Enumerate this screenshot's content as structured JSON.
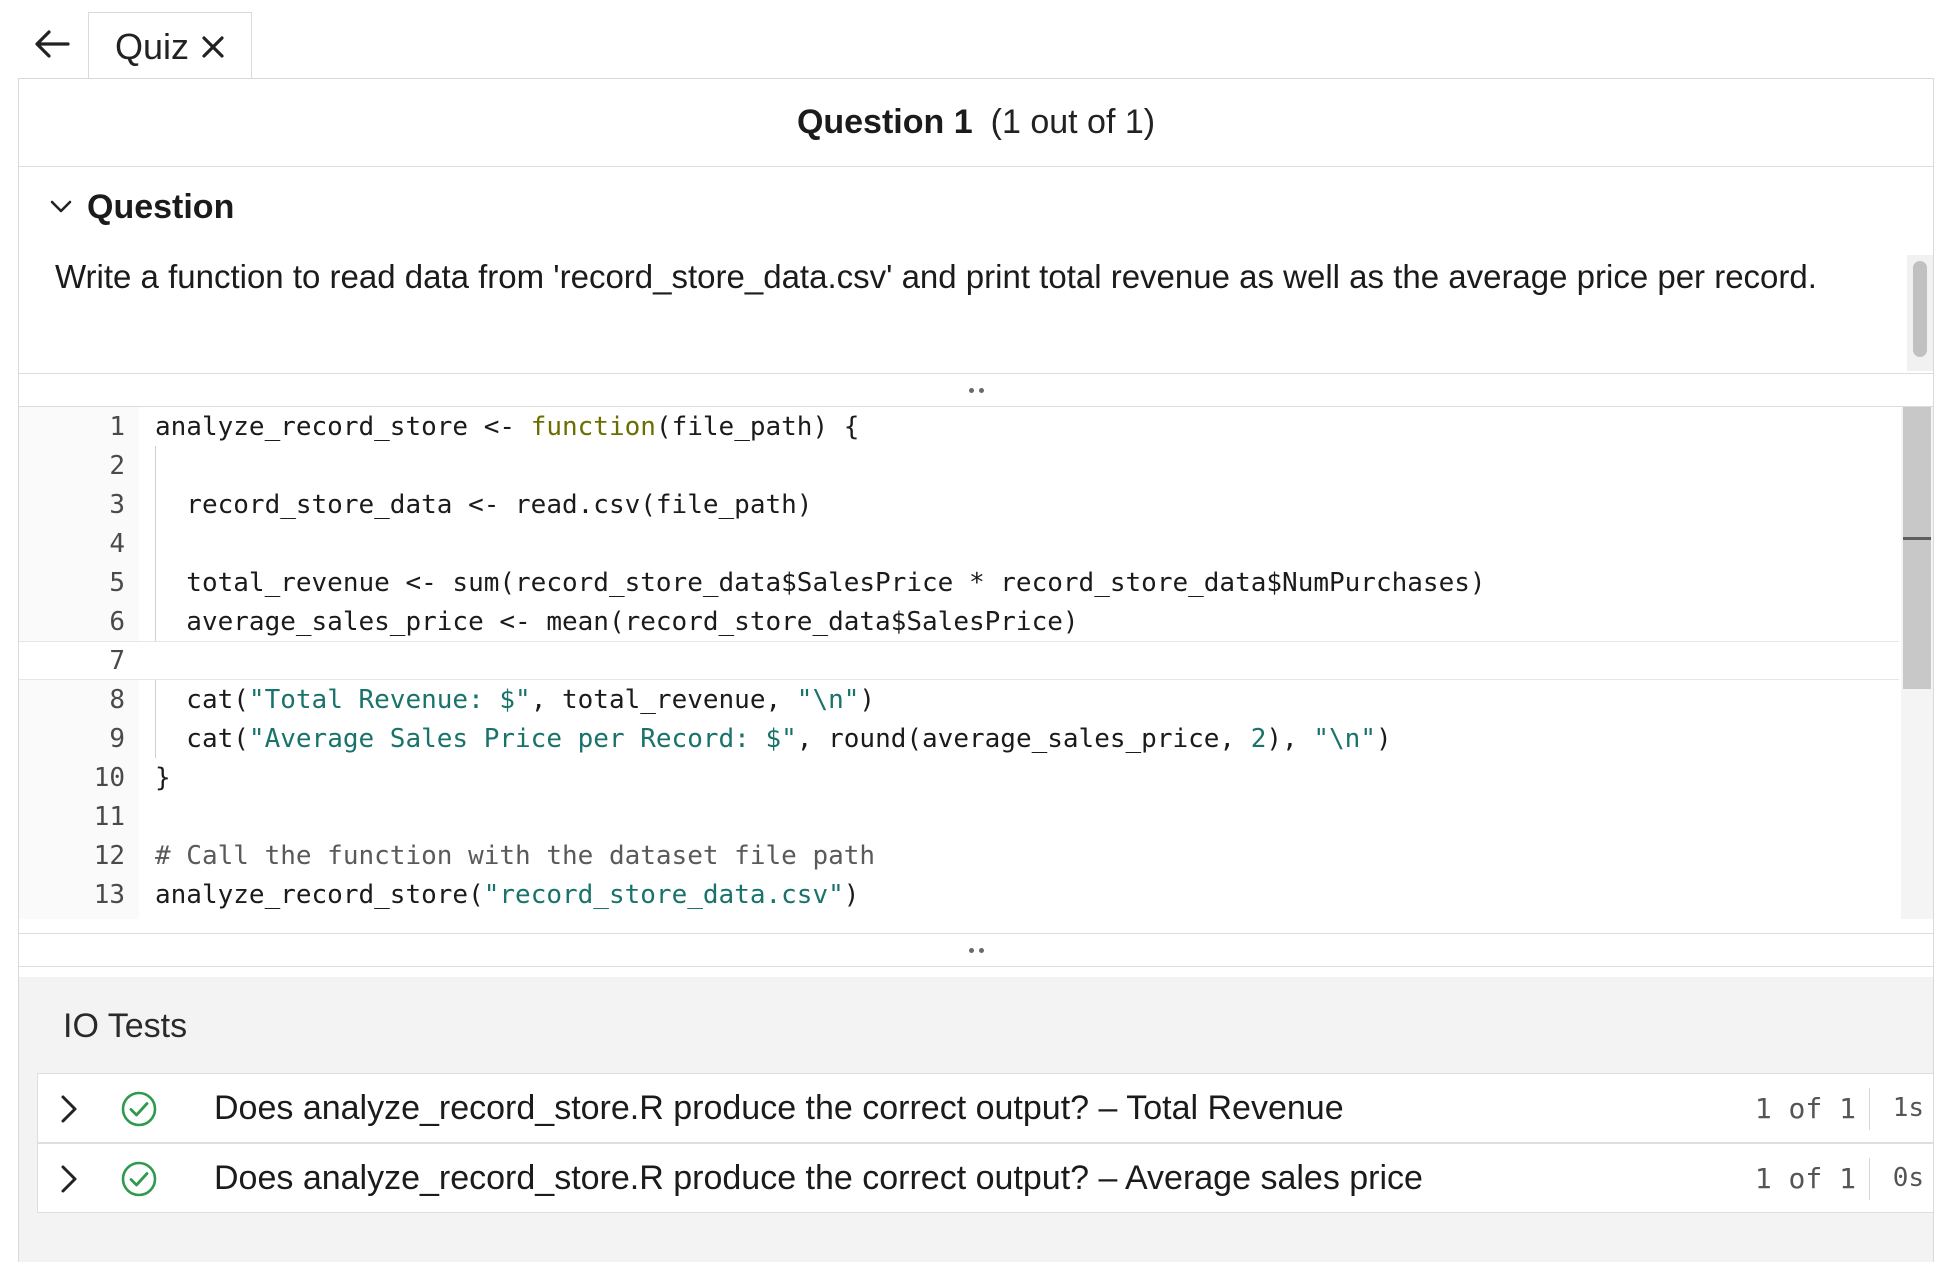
{
  "tab": {
    "label": "Quiz"
  },
  "header": {
    "title": "Question 1",
    "count": "(1 out of 1)"
  },
  "question": {
    "section_label": "Question",
    "text": "Write a function to read data from 'record_store_data.csv' and print total revenue as well as the average price per record."
  },
  "code": {
    "line_numbers": [
      "1",
      "2",
      "3",
      "4",
      "5",
      "6",
      "7",
      "8",
      "9",
      "10",
      "11",
      "12",
      "13"
    ],
    "lines": {
      "l1_a": "analyze_record_store <- ",
      "l1_b": "function",
      "l1_c": "(file_path) {",
      "l3": "  record_store_data <- read.csv(file_path)",
      "l5": "  total_revenue <- sum(record_store_data$SalesPrice * record_store_data$NumPurchases)",
      "l6": "  average_sales_price <- mean(record_store_data$SalesPrice)",
      "l8_a": "  cat(",
      "l8_b": "\"Total Revenue: $\"",
      "l8_c": ", total_revenue, ",
      "l8_d": "\"\\n\"",
      "l8_e": ")",
      "l9_a": "  cat(",
      "l9_b": "\"Average Sales Price per Record: $\"",
      "l9_c": ", round(average_sales_price, ",
      "l9_d": "2",
      "l9_e": "), ",
      "l9_f": "\"\\n\"",
      "l9_g": ")",
      "l10": "}",
      "l12": "# Call the function with the dataset file path",
      "l13_a": "analyze_record_store(",
      "l13_b": "\"record_store_data.csv\"",
      "l13_c": ")"
    }
  },
  "io_tests": {
    "title": "IO Tests",
    "items": [
      {
        "label": "Does analyze_record_store.R produce the correct output? – Total Revenue",
        "count": "1 of 1",
        "time": "1s"
      },
      {
        "label": "Does analyze_record_store.R produce the correct output? – Average sales price",
        "count": "1 of 1",
        "time": "0s"
      }
    ]
  },
  "colors": {
    "pass": "#2e9a4f",
    "keyword": "#6b6f00",
    "string": "#19736b"
  },
  "icons": {
    "back": "arrow-left-icon",
    "close": "close-icon",
    "collapse": "chevron-down-icon",
    "expand": "chevron-right-icon",
    "pass": "check-circle-icon"
  }
}
